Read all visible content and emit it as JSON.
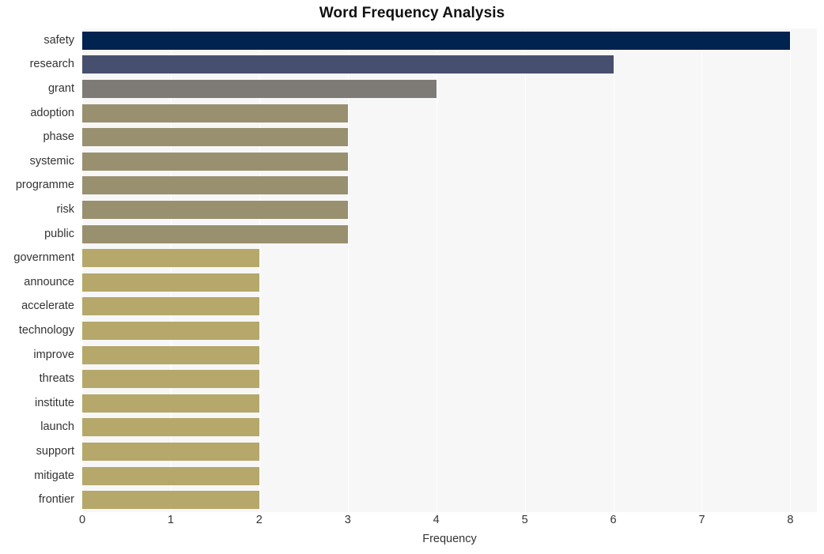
{
  "chart_data": {
    "type": "bar",
    "orientation": "horizontal",
    "title": "Word Frequency Analysis",
    "xlabel": "Frequency",
    "ylabel": "",
    "xlim": [
      0,
      8.3
    ],
    "xticks": [
      "0",
      "1",
      "2",
      "3",
      "4",
      "5",
      "6",
      "7",
      "8"
    ],
    "xtick_values": [
      0,
      1,
      2,
      3,
      4,
      5,
      6,
      7,
      8
    ],
    "grid": "vertical-white-on-light-gray",
    "legend": "none",
    "categories": [
      "safety",
      "research",
      "grant",
      "adoption",
      "phase",
      "systemic",
      "programme",
      "risk",
      "public",
      "government",
      "announce",
      "accelerate",
      "technology",
      "improve",
      "threats",
      "institute",
      "launch",
      "support",
      "mitigate",
      "frontier"
    ],
    "values": [
      8,
      6,
      4,
      3,
      3,
      3,
      3,
      3,
      3,
      2,
      2,
      2,
      2,
      2,
      2,
      2,
      2,
      2,
      2,
      2
    ],
    "bar_colors": [
      "#00234f",
      "#474f6e",
      "#7e7b77",
      "#99906f",
      "#99906f",
      "#99906f",
      "#99906f",
      "#99906f",
      "#99906f",
      "#b5a86a",
      "#b5a86a",
      "#b5a86a",
      "#b5a86a",
      "#b5a86a",
      "#b5a86a",
      "#b5a86a",
      "#b5a86a",
      "#b5a86a",
      "#b5a86a",
      "#b5a86a"
    ]
  },
  "style": {
    "figure_background": "#ffffff",
    "plot_background": "#f7f7f7",
    "gridline_color": "#ffffff",
    "text_color": "#333333",
    "title_color": "#111111"
  }
}
